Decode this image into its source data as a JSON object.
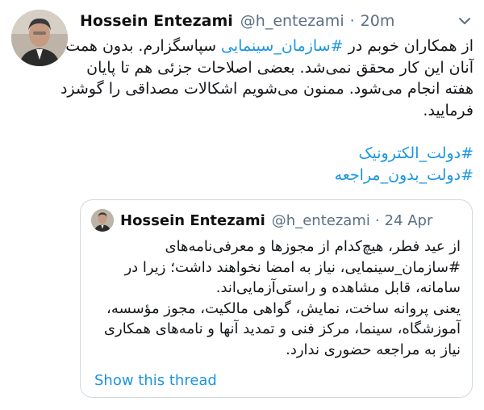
{
  "tweet": {
    "author_name": "Hossein Entezami",
    "handle": "@h_entezami",
    "separator": "·",
    "time": "20m",
    "more_icon": "chevron-down-icon",
    "body": {
      "line1_pre": "از همکاران خوبم در ",
      "line1_link": "#سازمان_سینمایی",
      "line1_post": " سپاسگزارم. بدون همت",
      "line2": "آنان این کار محقق نمی‌شد. بعضی اصلاحات جزئی هم تا پایان",
      "line3": "هفته انجام می‌شود. ممنون می‌شویم اشکالات مصداقی را گوشزد",
      "line4": "فرمایید."
    },
    "hashtags": [
      "#دولت_الکترونیک",
      "#دولت_بدون_مراجعه"
    ]
  },
  "quote": {
    "author_name": "Hossein Entezami",
    "handle": "@h_entezami",
    "separator": "·",
    "date": "24 Apr",
    "lines": [
      "از عید فطر، هیچ‌کدام از مجوزها و معرفی‌نامه‌های",
      "#سازمان_سینمایی، نیاز به امضا نخواهند داشت؛ زیرا در",
      "سامانه، قابل مشاهده و راستی‌آزمایی‌اند.",
      "یعنی پروانه ساخت، نمایش، گواهی مالکیت، مجوز مؤسسه،",
      "آموزشگاه، سینما، مرکز فنی و تمدید آنها و نامه‌های همکاری",
      "نیاز به مراجعه حضوری ندارد."
    ],
    "show_thread": "Show this thread"
  },
  "colors": {
    "link": "#1b95e0",
    "muted": "#5b7083",
    "border": "#cfd9de"
  }
}
